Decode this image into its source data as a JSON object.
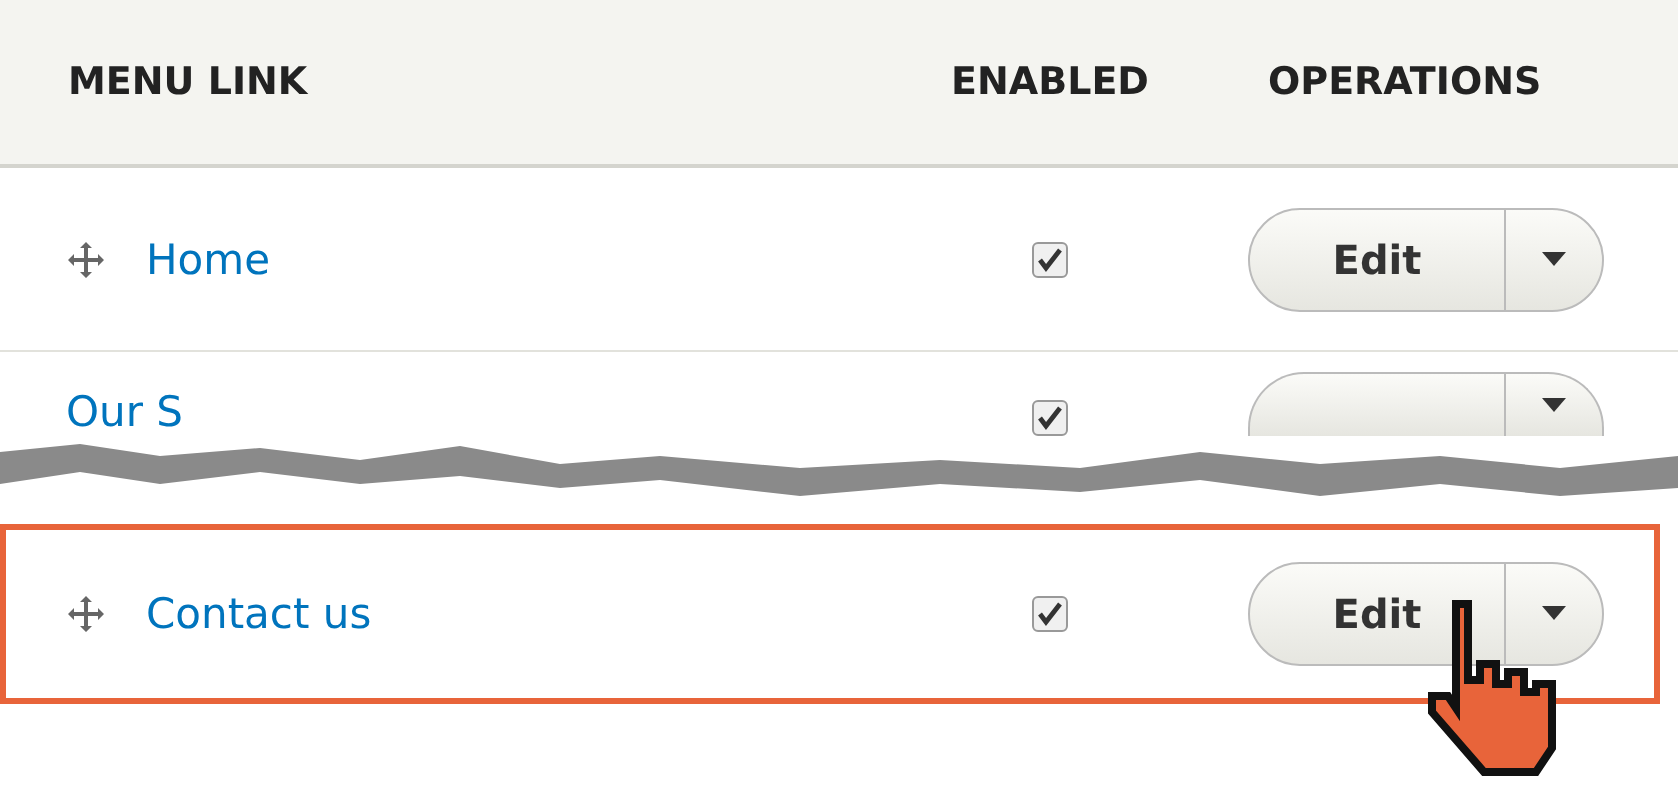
{
  "table": {
    "columns": [
      "MENU LINK",
      "ENABLED",
      "OPERATIONS"
    ],
    "rows": [
      {
        "kind": "normal",
        "title": "Home",
        "enabled": true,
        "button": "Edit",
        "highlighted": false
      },
      {
        "kind": "torn",
        "title": "Our S",
        "enabled": true,
        "highlighted": false
      },
      {
        "kind": "normal",
        "title": "Contact us",
        "enabled": true,
        "button": "Edit",
        "highlighted": true
      }
    ]
  }
}
